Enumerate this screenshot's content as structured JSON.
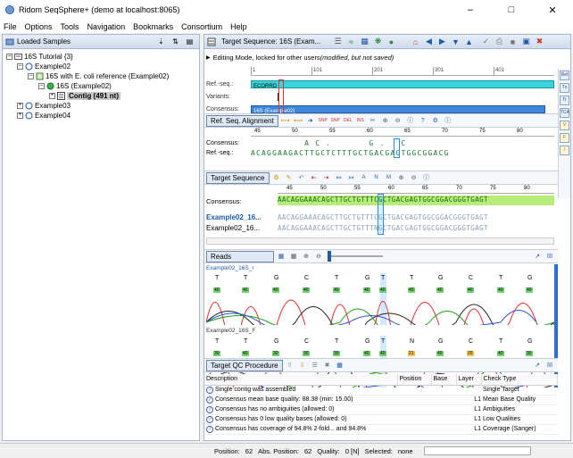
{
  "window": {
    "title": "Ridom SeqSphere+ (demo at localhost:8065)"
  },
  "menu": [
    "File",
    "Options",
    "Tools",
    "Navigation",
    "Bookmarks",
    "Consortium",
    "Help"
  ],
  "left_panel": {
    "title": "Loaded Samples",
    "tree": [
      {
        "label": "16S Tutorial {3}",
        "level": 0,
        "expanded": true
      },
      {
        "label": "Example02",
        "level": 1,
        "expanded": true
      },
      {
        "label": "16S with E. coli reference (Example02)",
        "level": 2,
        "expanded": true
      },
      {
        "label": "16S (Example02)",
        "level": 3,
        "expanded": true
      },
      {
        "label": "Contig (491 nt)",
        "level": 4,
        "expanded": false,
        "selected": true
      },
      {
        "label": "Example03",
        "level": 1,
        "expanded": false
      },
      {
        "label": "Example04",
        "level": 1,
        "expanded": false
      }
    ]
  },
  "right_panel": {
    "title": "Target Sequence: 16S (Exam...",
    "edit_banner_prefix": "Editing Mode, locked for other users ",
    "edit_banner_note": "(modified, but not saved)",
    "overview": {
      "ruler_ticks": [
        "1",
        "101",
        "201",
        "301",
        "401"
      ],
      "rows": [
        "Ref.-seq.:",
        "Variants:",
        "Consensus:"
      ],
      "ref_bar_label": "ECORRD",
      "consensus_bar_label": "16S (Example02)"
    },
    "ref_alignment": {
      "tab": "Ref. Seq. Alignment",
      "ruler_ticks": [
        "45",
        "50",
        "55",
        "60",
        "65",
        "70",
        "75",
        "80"
      ],
      "rows": [
        {
          "label": "Consensus:",
          "seq": "          A C .       G .   C         "
        },
        {
          "label": "Ref.-seq.:",
          "seq": "ACAGGAAGACTTGCTCTTTGCTGACGAGTGGCGGACG"
        }
      ]
    },
    "target_sequence": {
      "tab": "Target Sequence",
      "ruler_ticks": [
        "45",
        "50",
        "55",
        "60",
        "65",
        "70",
        "75",
        "80"
      ],
      "consensus_label": "Consensus:",
      "consensus_seq": "AACAGGAAACAGCTTGCTGTTTCGCTGACGAGTGGCGGACGGGTGAGT",
      "reads": [
        {
          "label": "Example02_16...",
          "seq": "AACAGGAAACAGCTTGCTGTTTCGCTGACGAGTGGCGGACGGGTGAGT",
          "bold": true
        },
        {
          "label": "Example02_16...",
          "seq": "AACAGGAAACAGCTTGCTGTTTNGCTGACGAGTGGCGGACGGGTGAGT",
          "bold": false
        }
      ]
    },
    "reads_panel": {
      "tab": "Reads",
      "traces": [
        {
          "label": "Example02_16S_r",
          "bases": [
            "T",
            "T",
            "G",
            "C",
            "T",
            "G",
            "T",
            "T",
            "G",
            "C",
            "T",
            "G"
          ],
          "quals": [
            "40",
            "40",
            "40",
            "40",
            "40",
            "40",
            "40",
            "40",
            "40",
            "40",
            "40",
            "40"
          ]
        },
        {
          "label": "Example02_16S_F",
          "bases": [
            "T",
            "T",
            "G",
            "C",
            "T",
            "G",
            "T",
            "N",
            "G",
            "C",
            "T",
            "G"
          ],
          "quals": [
            "30",
            "40",
            "30",
            "30",
            "30",
            "40",
            "40",
            "21",
            "40",
            "20",
            "40",
            "30"
          ]
        }
      ]
    },
    "qc": {
      "tab": "Target QC Procedure",
      "columns": [
        "Description",
        "Position",
        "Base",
        "Layer",
        "Check Type"
      ],
      "rows": [
        {
          "desc": "Single contig was assembled",
          "pos": "",
          "base": "",
          "layer": "",
          "type": "Single Target"
        },
        {
          "desc": "Consensus mean base quality: 88.38 (min: 15.00)",
          "pos": "",
          "base": "",
          "layer": "L1",
          "type": "Mean Base Quality"
        },
        {
          "desc": "Consensus has no ambiguities (allowed: 0)",
          "pos": "",
          "base": "",
          "layer": "L1",
          "type": "Ambiguities"
        },
        {
          "desc": "Consensus has 0 low quality bases (allowed: 0)",
          "pos": "",
          "base": "",
          "layer": "L1",
          "type": "Low Qualities"
        },
        {
          "desc": "Consensus has coverage of 94.8% 2-fold... and 94.8%",
          "pos": "",
          "base": "",
          "layer": "L1",
          "type": "Coverage (Sanger)"
        }
      ]
    }
  },
  "status_bar": {
    "position_label": "Position:",
    "position": "62",
    "abs_label": "Abs. Position:",
    "abs": "62",
    "quality_label": "Quality:",
    "quality": "0 [N]",
    "selected_label": "Selected:",
    "selected": "none"
  }
}
